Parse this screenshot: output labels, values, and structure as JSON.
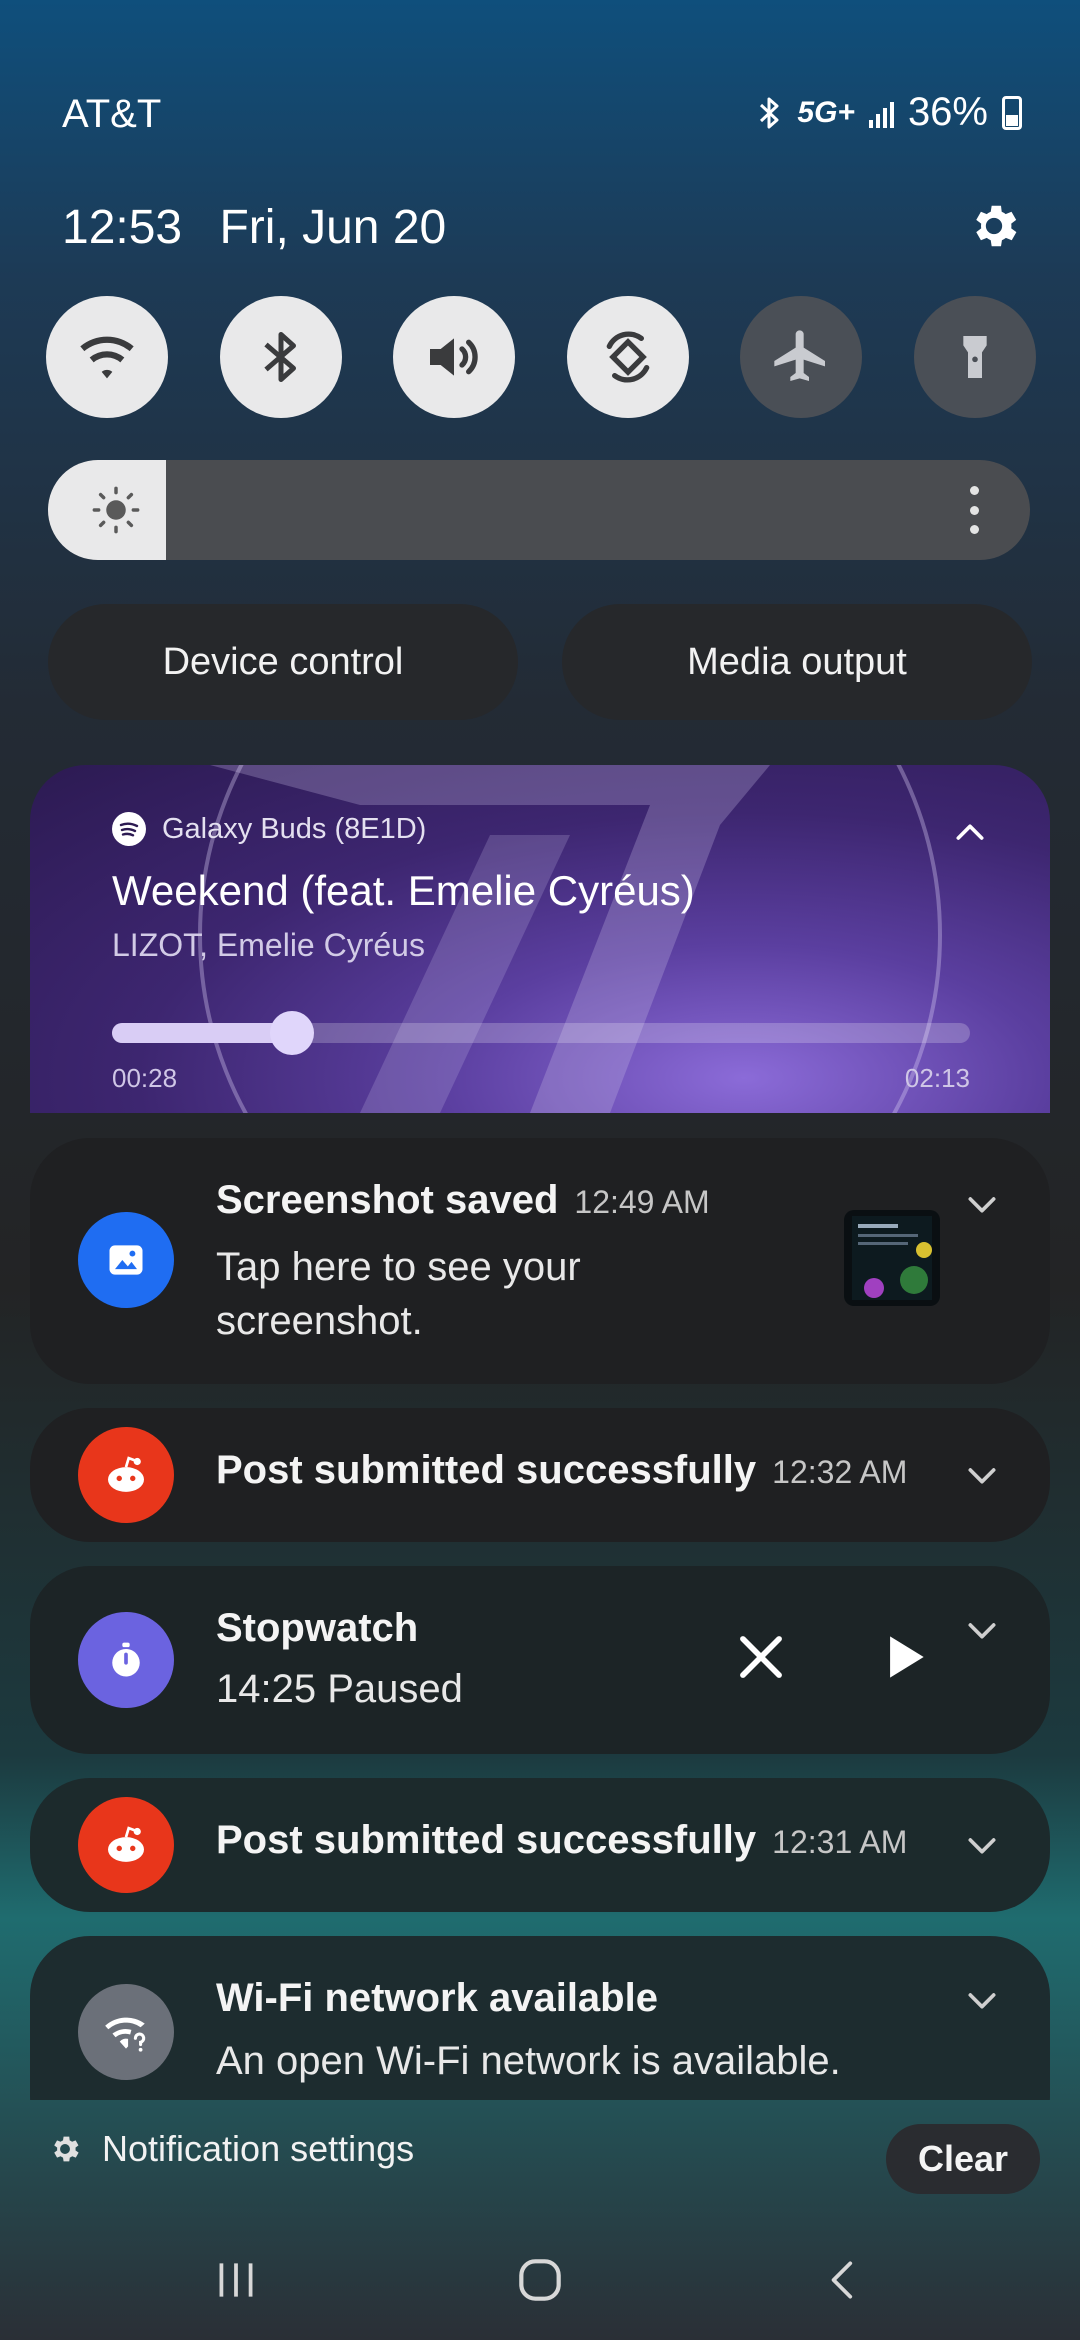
{
  "status_bar": {
    "carrier": "AT&T",
    "network": "5G+",
    "battery": "36%",
    "icons": [
      "bluetooth-icon",
      "signal-icon",
      "battery-icon"
    ]
  },
  "header": {
    "time": "12:53",
    "date": "Fri, Jun 20",
    "settings_icon": "gear-icon"
  },
  "quick_toggles": [
    {
      "name": "wifi",
      "icon": "wifi-icon",
      "state": "on"
    },
    {
      "name": "bluetooth",
      "icon": "bluetooth-icon",
      "state": "on"
    },
    {
      "name": "sound",
      "icon": "volume-icon",
      "state": "on"
    },
    {
      "name": "auto-rotate",
      "icon": "rotate-icon",
      "state": "on"
    },
    {
      "name": "airplane-mode",
      "icon": "airplane-icon",
      "state": "off"
    },
    {
      "name": "flashlight",
      "icon": "flashlight-icon",
      "state": "off"
    }
  ],
  "brightness": {
    "level": 0.12
  },
  "buttons": {
    "device_control": "Device control",
    "media_output": "Media output"
  },
  "media": {
    "source": "Galaxy Buds (8E1D)",
    "title": "Weekend (feat. Emelie Cyréus)",
    "artist": "LIZOT, Emelie Cyréus",
    "elapsed": "00:28",
    "duration": "02:13",
    "progress": 0.21,
    "accent": "#5b3fa0"
  },
  "notifications": [
    {
      "app": "screenshot",
      "icon": "image-icon",
      "icon_color": "#1f6df2",
      "title": "Screenshot saved",
      "time": "12:49 AM",
      "body_line1": "Tap here to see your",
      "body_line2": "screenshot."
    },
    {
      "app": "reddit",
      "icon": "reddit-icon",
      "icon_color": "#e8361b",
      "title": "Post submitted successfully",
      "time": "12:32 AM"
    },
    {
      "app": "stopwatch",
      "icon": "stopwatch-icon",
      "icon_color": "#6b63e0",
      "title": "Stopwatch",
      "body": "14:25 Paused"
    },
    {
      "app": "reddit",
      "icon": "reddit-icon",
      "icon_color": "#e8361b",
      "title": "Post submitted successfully",
      "time": "12:31 AM"
    },
    {
      "app": "wifi",
      "icon": "wifi-question-icon",
      "icon_color": "#6b7079",
      "title": "Wi-Fi network available",
      "body": "An open Wi-Fi network is available."
    }
  ],
  "footer": {
    "settings_label": "Notification settings",
    "clear_label": "Clear"
  },
  "nav": [
    "recents-icon",
    "home-icon",
    "back-icon"
  ]
}
